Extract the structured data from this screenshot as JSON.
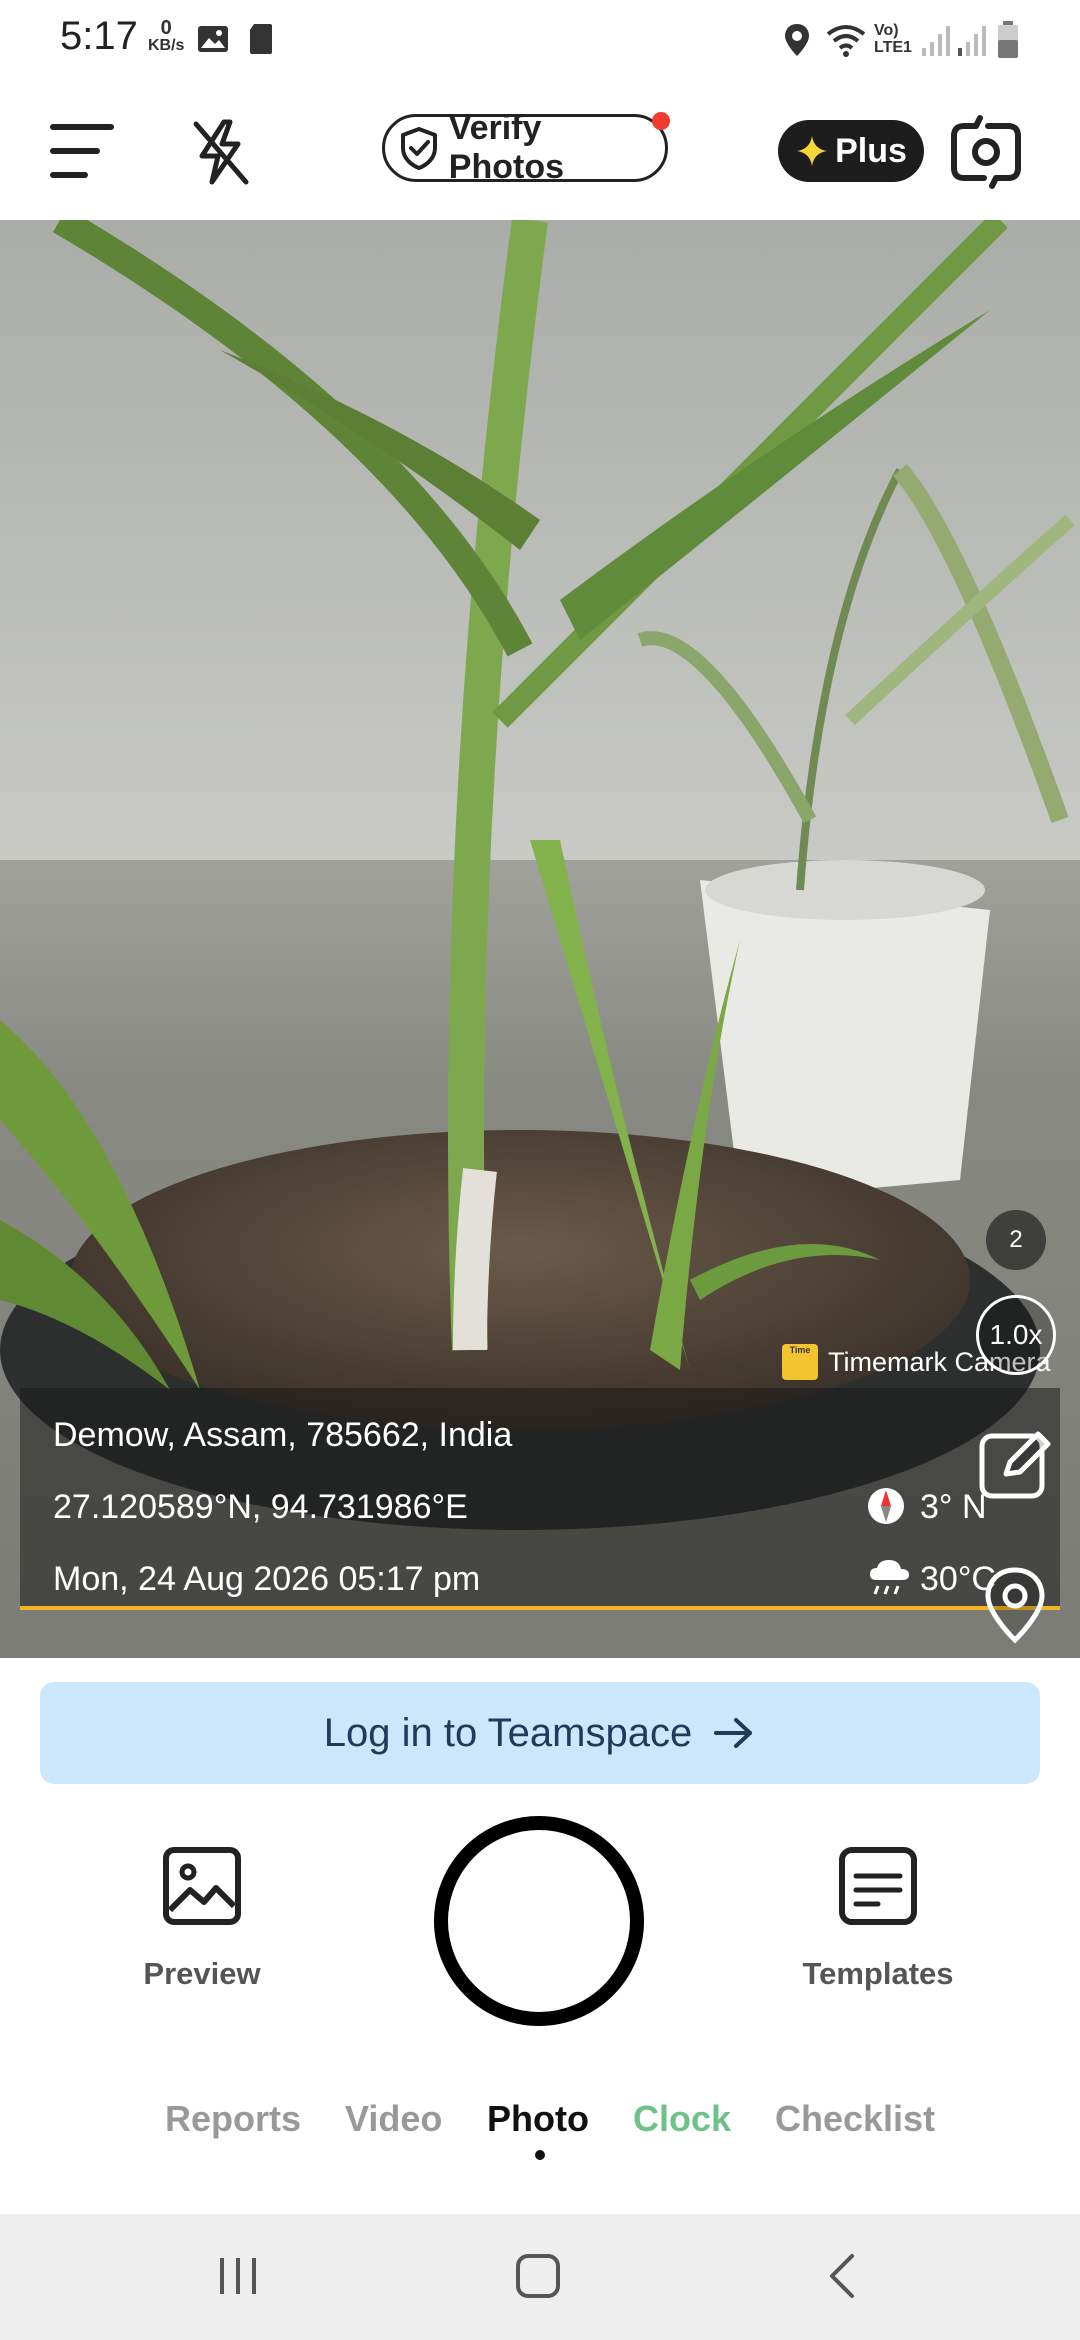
{
  "status_bar": {
    "time": "5:17",
    "speed_value": "0",
    "speed_unit": "KB/s",
    "net_label_1": "Vo)",
    "net_label_2": "LTE1"
  },
  "top_bar": {
    "verify_label": "Verify Photos",
    "plus_label": "Plus",
    "notification_color": "#f23b2f"
  },
  "viewfinder": {
    "photo_count": "2",
    "zoom": "1.0x",
    "brand_logo_text": "Time",
    "brand": "Timemark Camera",
    "location": "Demow, Assam, 785662, India",
    "coordinates": "27.120589°N, 94.731986°E",
    "datetime": "Mon, 24 Aug 2026 05:17 pm",
    "heading": "3° N",
    "temperature": "30°C",
    "accent_color": "#f2b325"
  },
  "login_banner": {
    "label": "Log in to Teamspace"
  },
  "actions": {
    "preview_label": "Preview",
    "templates_label": "Templates"
  },
  "modes": {
    "items": [
      "Reports",
      "Video",
      "Photo",
      "Clock",
      "Checklist"
    ],
    "active": "Photo"
  }
}
